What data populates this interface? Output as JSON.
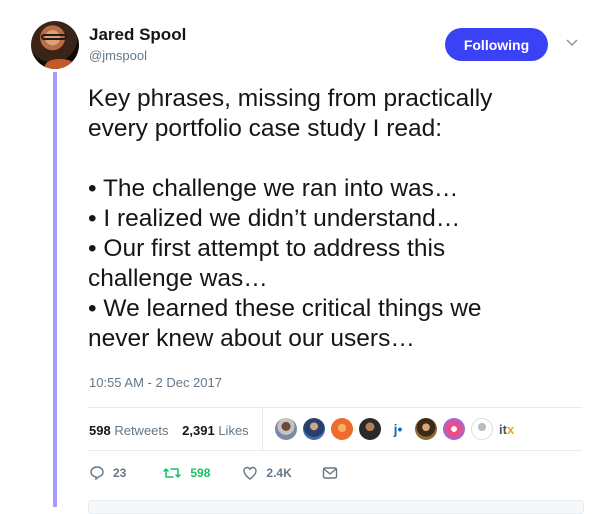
{
  "author": {
    "name": "Jared Spool",
    "handle": "@jmspool"
  },
  "follow_button": {
    "label": "Following",
    "color": "#3b41f5"
  },
  "tweet": {
    "text": "Key phrases, missing from practically\nevery portfolio case study I read:\n\n• The challenge we ran into was…\n• I realized we didn’t understand…\n• Our first attempt to address this\nchallenge was…\n• We learned these critical things we\nnever knew about our users…",
    "timestamp": "10:55 AM - 2 Dec 2017"
  },
  "stats": {
    "retweets_count": "598",
    "retweets_label": "Retweets",
    "likes_count": "2,391",
    "likes_label": "Likes"
  },
  "likers": [
    {
      "icon": "liker-avatar-1"
    },
    {
      "icon": "liker-avatar-2"
    },
    {
      "icon": "liker-avatar-3"
    },
    {
      "icon": "liker-avatar-4"
    },
    {
      "icon": "liker-avatar-j",
      "text": "j•"
    },
    {
      "icon": "liker-avatar-6"
    },
    {
      "icon": "liker-avatar-7"
    },
    {
      "icon": "liker-avatar-8"
    },
    {
      "icon": "liker-avatar-itx",
      "text_a": "it",
      "text_b": "x"
    }
  ],
  "actions": {
    "reply_count": "23",
    "retweet_count": "598",
    "like_count": "2.4K"
  },
  "colors": {
    "thread_line": "#a59cff",
    "retweet_green": "#17bf63",
    "secondary_text": "#657786"
  }
}
